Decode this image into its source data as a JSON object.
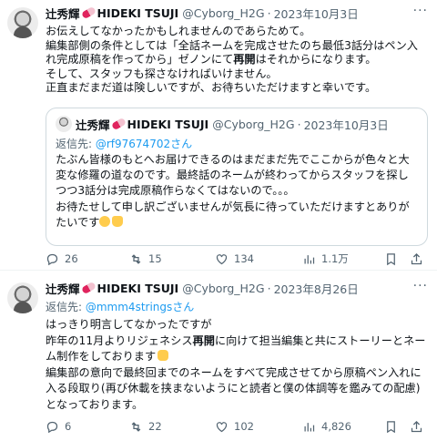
{
  "tweets": [
    {
      "author": {
        "name_pre": "辻秀輝",
        "name_post": "HIDEKI TSUJI",
        "handle": "@Cyborg_H2G",
        "time": "2023年10月3日"
      },
      "text": {
        "l1": "お伝えしてなかったかもしれませんのであらためて。",
        "l2": "編集部側の条件としては「全話ネームを完成させたのち最低3話分はペン入",
        "l3": "れ完成原稿を作ってから」ゼノンにて",
        "l3_bold": "再開",
        "l3_post": "はそれからになります。",
        "l4": "そして、スタッフも探さなければいけません。",
        "l5": "正直まだまだ道は険しいですが、お待ちいただけますと幸いです。"
      },
      "quote": {
        "author": {
          "name_pre": "辻秀輝",
          "name_post": "HIDEKI TSUJI",
          "handle": "@Cyborg_H2G",
          "time": "2023年10月3日"
        },
        "replying_label": "返信先: ",
        "replying_to": "@rf97674702さん",
        "lines": [
          "たぶん皆様のもとへお届けできるのはまだまだ先でここからが色々と大",
          "変な修羅の道なのです。最終話のネームが終わってからスタッフを探し",
          "つつ3話分は完成原稿作らなくてはないので。。。",
          "お待たせして申し訳ございませんが気長に待っていただけますとありが",
          "たいです"
        ]
      },
      "stats": {
        "replies": "26",
        "retweets": "15",
        "likes": "134",
        "views": "1.1万"
      }
    },
    {
      "author": {
        "name_pre": "辻秀輝",
        "name_post": "HIDEKI TSUJI",
        "handle": "@Cyborg_H2G",
        "time": "2023年8月26日"
      },
      "replying_label": "返信先: ",
      "replying_to": "@mmm4stringsさん",
      "text": {
        "l1": "はっきり明言してなかったですが",
        "l2_pre": "昨年の11月よりリジェネシス",
        "l2_bold": "再開",
        "l2_post": "に向けて担当編集と共にストーリーとネー",
        "l3": "ム制作をしております",
        "l4": "編集部の意向で最終回までのネームをすべて完成させてから原稿ペン入れに",
        "l5": "入る段取り(再び休載を挟まないようにと読者と僕の体調等を鑑みての配慮)",
        "l6": "となっております。"
      },
      "stats": {
        "replies": "6",
        "retweets": "22",
        "likes": "102",
        "views": "4,826"
      }
    }
  ],
  "icons": {
    "more": "more-horizontal-icon",
    "reply": "reply-icon",
    "retweet": "retweet-icon",
    "like": "heart-icon",
    "views": "views-chart-icon"
  },
  "colors": {
    "link": "#1d9bf0",
    "secondary": "#536471",
    "text": "#0f1419",
    "border": "#cfd9de"
  }
}
